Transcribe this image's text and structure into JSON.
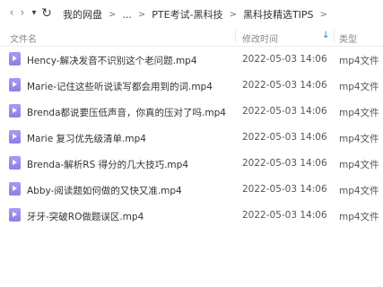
{
  "nav": {
    "back_icon": "chevron-left-icon",
    "forward_icon": "chevron-right-icon",
    "dropdown_icon": "chevron-down-icon",
    "refresh_icon": "refresh-icon",
    "back_glyph": "‹",
    "forward_glyph": "›",
    "dropdown_glyph": "▾",
    "refresh_glyph": "↻"
  },
  "breadcrumb": {
    "items": [
      "我的网盘",
      "...",
      "PTE考试-黑科技",
      "黑科技精选TIPS"
    ],
    "separator": ">"
  },
  "columns": {
    "name": "文件名",
    "date": "修改时间",
    "type": "类型",
    "sort_glyph": "↓"
  },
  "files": [
    {
      "name": "Hency-解决发音不识别这个老问题.mp4",
      "date": "2022-05-03 14:06",
      "type": "mp4文件"
    },
    {
      "name": "Marie-记住这些听说读写都会用到的词.mp4",
      "date": "2022-05-03 14:06",
      "type": "mp4文件"
    },
    {
      "name": "Brenda都说要压低声音，你真的压对了吗.mp4",
      "date": "2022-05-03 14:06",
      "type": "mp4文件"
    },
    {
      "name": "Marie 复习优先级清单.mp4",
      "date": "2022-05-03 14:06",
      "type": "mp4文件"
    },
    {
      "name": "Brenda-解析RS 得分的几大技巧.mp4",
      "date": "2022-05-03 14:06",
      "type": "mp4文件"
    },
    {
      "name": "Abby-阅读题如何做的又快又准.mp4",
      "date": "2022-05-03 14:06",
      "type": "mp4文件"
    },
    {
      "name": "牙牙-突破RO做题误区.mp4",
      "date": "2022-05-03 14:06",
      "type": "mp4文件"
    }
  ],
  "colors": {
    "accent": "#2a7cd9",
    "video_icon": "#8b7ee6"
  }
}
